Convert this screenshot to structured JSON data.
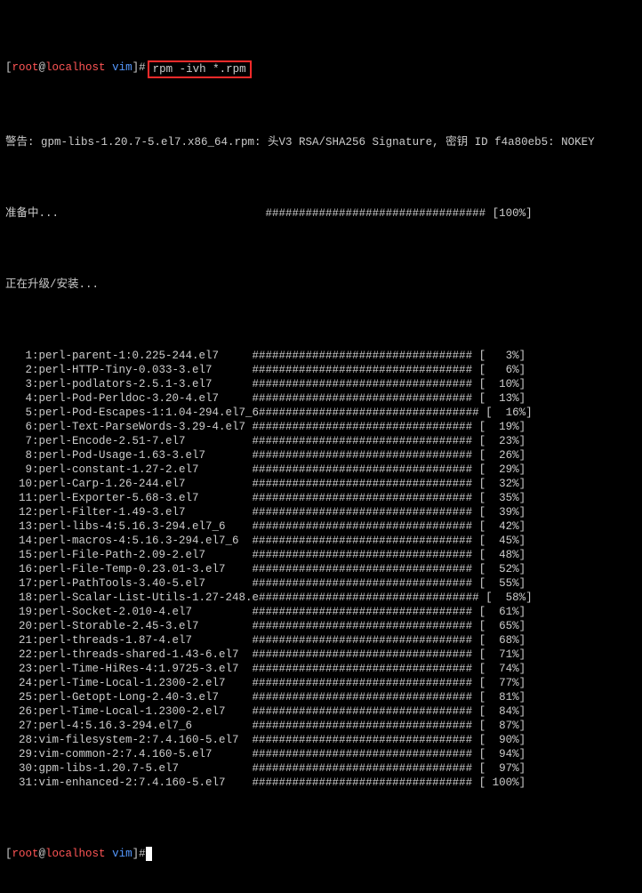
{
  "prompt": {
    "user": "root",
    "host": "localhost",
    "cwd": "vim",
    "sep_open": "[",
    "sep_at": "@",
    "sep_space": " ",
    "sep_close": "]",
    "hash": "#"
  },
  "command_box": "rpm -ivh *.rpm",
  "warning_line": "警告: gpm-libs-1.20.7-5.el7.x86_64.rpm: 头V3 RSA/SHA256 Signature, 密钥 ID f4a80eb5: NOKEY",
  "preparing": {
    "label": "准备中...",
    "bar": "################################# [100%]"
  },
  "upgrading_label": "正在升级/安装...",
  "bar_string": "#################################",
  "packages": [
    {
      "idx": "1",
      "name": "perl-parent-1:0.225-244.el7",
      "pct": "3"
    },
    {
      "idx": "2",
      "name": "perl-HTTP-Tiny-0.033-3.el7",
      "pct": "6"
    },
    {
      "idx": "3",
      "name": "perl-podlators-2.5.1-3.el7",
      "pct": "10"
    },
    {
      "idx": "4",
      "name": "perl-Pod-Perldoc-3.20-4.el7",
      "pct": "13"
    },
    {
      "idx": "5",
      "name": "perl-Pod-Escapes-1:1.04-294.el7_6",
      "pct": "16"
    },
    {
      "idx": "6",
      "name": "perl-Text-ParseWords-3.29-4.el7",
      "pct": "19"
    },
    {
      "idx": "7",
      "name": "perl-Encode-2.51-7.el7",
      "pct": "23"
    },
    {
      "idx": "8",
      "name": "perl-Pod-Usage-1.63-3.el7",
      "pct": "26"
    },
    {
      "idx": "9",
      "name": "perl-constant-1.27-2.el7",
      "pct": "29"
    },
    {
      "idx": "10",
      "name": "perl-Carp-1.26-244.el7",
      "pct": "32"
    },
    {
      "idx": "11",
      "name": "perl-Exporter-5.68-3.el7",
      "pct": "35"
    },
    {
      "idx": "12",
      "name": "perl-Filter-1.49-3.el7",
      "pct": "39"
    },
    {
      "idx": "13",
      "name": "perl-libs-4:5.16.3-294.el7_6",
      "pct": "42"
    },
    {
      "idx": "14",
      "name": "perl-macros-4:5.16.3-294.el7_6",
      "pct": "45"
    },
    {
      "idx": "15",
      "name": "perl-File-Path-2.09-2.el7",
      "pct": "48"
    },
    {
      "idx": "16",
      "name": "perl-File-Temp-0.23.01-3.el7",
      "pct": "52"
    },
    {
      "idx": "17",
      "name": "perl-PathTools-3.40-5.el7",
      "pct": "55"
    },
    {
      "idx": "18",
      "name": "perl-Scalar-List-Utils-1.27-248.e",
      "pct": "58"
    },
    {
      "idx": "19",
      "name": "perl-Socket-2.010-4.el7",
      "pct": "61"
    },
    {
      "idx": "20",
      "name": "perl-Storable-2.45-3.el7",
      "pct": "65"
    },
    {
      "idx": "21",
      "name": "perl-threads-1.87-4.el7",
      "pct": "68"
    },
    {
      "idx": "22",
      "name": "perl-threads-shared-1.43-6.el7",
      "pct": "71"
    },
    {
      "idx": "23",
      "name": "perl-Time-HiRes-4:1.9725-3.el7",
      "pct": "74"
    },
    {
      "idx": "24",
      "name": "perl-Time-Local-1.2300-2.el7",
      "pct": "77"
    },
    {
      "idx": "25",
      "name": "perl-Getopt-Long-2.40-3.el7",
      "pct": "81"
    },
    {
      "idx": "26",
      "name": "perl-Time-Local-1.2300-2.el7",
      "pct": "84"
    },
    {
      "idx": "27",
      "name": "perl-4:5.16.3-294.el7_6",
      "pct": "87"
    },
    {
      "idx": "28",
      "name": "vim-filesystem-2:7.4.160-5.el7",
      "pct": "90"
    },
    {
      "idx": "29",
      "name": "vim-common-2:7.4.160-5.el7",
      "pct": "94"
    },
    {
      "idx": "30",
      "name": "gpm-libs-1.20.7-5.el7",
      "pct": "97"
    },
    {
      "idx": "31",
      "name": "vim-enhanced-2:7.4.160-5.el7",
      "pct": "100"
    }
  ],
  "cols": {
    "name_width": 33,
    "before_bar_width": 37
  },
  "final_prompt": {
    "cursor": " "
  }
}
